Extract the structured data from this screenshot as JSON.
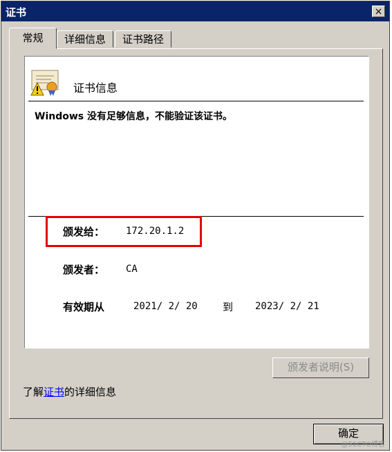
{
  "window": {
    "title": "证书",
    "close_label": "×"
  },
  "tabs": [
    {
      "label": "常规",
      "active": true
    },
    {
      "label": "详细信息",
      "active": false
    },
    {
      "label": "证书路径",
      "active": false
    }
  ],
  "info": {
    "icon": "certificate-warning-icon",
    "title": "证书信息",
    "warning": "Windows 没有足够信息，不能验证该证书。",
    "issued_to_label": "颁发给：",
    "issued_to_value": "172.20.1.2",
    "issued_by_label": "颁发者：",
    "issued_by_value": "CA",
    "valid_label": "有效期从",
    "valid_from": "2021/ 2/ 20",
    "valid_to_word": "到",
    "valid_to": "2023/ 2/ 21"
  },
  "buttons": {
    "issuer_statement": "颁发者说明(S)",
    "ok": "确定"
  },
  "learn_more": {
    "prefix": "了解",
    "link": "证书",
    "suffix": "的详细信息"
  },
  "watermark": "@51CTO博客",
  "colors": {
    "titlebar": "#0a246a",
    "dialog_face": "#d4d0c8",
    "highlight_border": "#e50000",
    "link": "#0000ff"
  }
}
